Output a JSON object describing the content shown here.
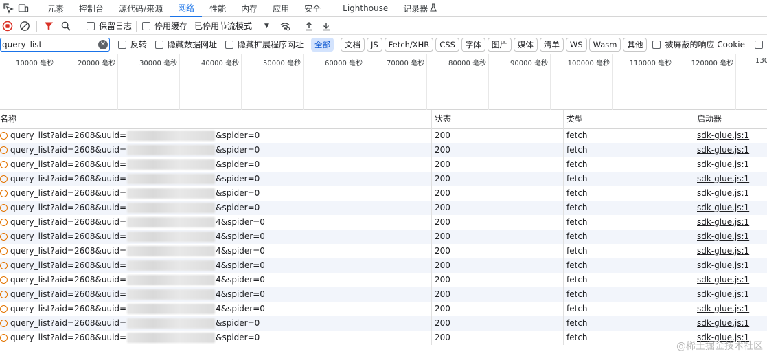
{
  "tabs": {
    "elements": "元素",
    "console": "控制台",
    "sources": "源代码/来源",
    "network": "网络",
    "performance": "性能",
    "memory": "内存",
    "application": "应用",
    "security": "安全",
    "lighthouse": "Lighthouse",
    "recorder": "记录器"
  },
  "toolbar": {
    "preserve_log": "保留日志",
    "disable_cache": "停用缓存",
    "throttling": "已停用节流模式"
  },
  "filter": {
    "value": "query_list",
    "invert": "反转",
    "hide_data_urls": "隐藏数据网址",
    "hide_ext_urls": "隐藏扩展程序网址",
    "types": [
      "全部",
      "文档",
      "JS",
      "Fetch/XHR",
      "CSS",
      "字体",
      "图片",
      "媒体",
      "清单",
      "WS",
      "Wasm",
      "其他"
    ],
    "blocked_cookies": "被屏蔽的响应 Cookie"
  },
  "timeline": {
    "ticks": [
      "10000 毫秒",
      "20000 毫秒",
      "30000 毫秒",
      "40000 毫秒",
      "50000 毫秒",
      "60000 毫秒",
      "70000 毫秒",
      "80000 毫秒",
      "90000 毫秒",
      "100000 毫秒",
      "110000 毫秒",
      "120000 毫秒",
      "130"
    ]
  },
  "table": {
    "headers": {
      "name": "名称",
      "status": "状态",
      "type": "类型",
      "initiator": "启动器"
    },
    "rows": [
      {
        "name_prefix": "query_list?aid=2608&uuid=",
        "name_suffix": "&spider=0",
        "status": "200",
        "type": "fetch",
        "initiator": "sdk-glue.js:1"
      },
      {
        "name_prefix": "query_list?aid=2608&uuid=",
        "name_suffix": "&spider=0",
        "status": "200",
        "type": "fetch",
        "initiator": "sdk-glue.js:1"
      },
      {
        "name_prefix": "query_list?aid=2608&uuid=",
        "name_suffix": "&spider=0",
        "status": "200",
        "type": "fetch",
        "initiator": "sdk-glue.js:1"
      },
      {
        "name_prefix": "query_list?aid=2608&uuid=",
        "name_suffix": "&spider=0",
        "status": "200",
        "type": "fetch",
        "initiator": "sdk-glue.js:1"
      },
      {
        "name_prefix": "query_list?aid=2608&uuid=",
        "name_suffix": "&spider=0",
        "status": "200",
        "type": "fetch",
        "initiator": "sdk-glue.js:1"
      },
      {
        "name_prefix": "query_list?aid=2608&uuid=",
        "name_suffix": "&spider=0",
        "status": "200",
        "type": "fetch",
        "initiator": "sdk-glue.js:1"
      },
      {
        "name_prefix": "query_list?aid=2608&uuid=",
        "name_suffix": "4&spider=0",
        "status": "200",
        "type": "fetch",
        "initiator": "sdk-glue.js:1"
      },
      {
        "name_prefix": "query_list?aid=2608&uuid=",
        "name_suffix": "4&spider=0",
        "status": "200",
        "type": "fetch",
        "initiator": "sdk-glue.js:1"
      },
      {
        "name_prefix": "query_list?aid=2608&uuid=",
        "name_suffix": "4&spider=0",
        "status": "200",
        "type": "fetch",
        "initiator": "sdk-glue.js:1"
      },
      {
        "name_prefix": "query_list?aid=2608&uuid=",
        "name_suffix": "4&spider=0",
        "status": "200",
        "type": "fetch",
        "initiator": "sdk-glue.js:1"
      },
      {
        "name_prefix": "query_list?aid=2608&uuid=",
        "name_suffix": "4&spider=0",
        "status": "200",
        "type": "fetch",
        "initiator": "sdk-glue.js:1"
      },
      {
        "name_prefix": "query_list?aid=2608&uuid=",
        "name_suffix": "4&spider=0",
        "status": "200",
        "type": "fetch",
        "initiator": "sdk-glue.js:1"
      },
      {
        "name_prefix": "query_list?aid=2608&uuid=",
        "name_suffix": "4&spider=0",
        "status": "200",
        "type": "fetch",
        "initiator": "sdk-glue.js:1"
      },
      {
        "name_prefix": "query_list?aid=2608&uuid=",
        "name_suffix": "&spider=0",
        "status": "200",
        "type": "fetch",
        "initiator": "sdk-glue.js:1"
      },
      {
        "name_prefix": "query_list?aid=2608&uuid=",
        "name_suffix": "&spider=0",
        "status": "200",
        "type": "fetch",
        "initiator": "sdk-glue.js:1"
      }
    ]
  },
  "watermark": "@稀土掘金技术社区",
  "colors": {
    "accent": "#1a73e8",
    "record_stop": "#d93025",
    "filter_funnel": "#d93025",
    "xhr_icon": "#e37400"
  }
}
